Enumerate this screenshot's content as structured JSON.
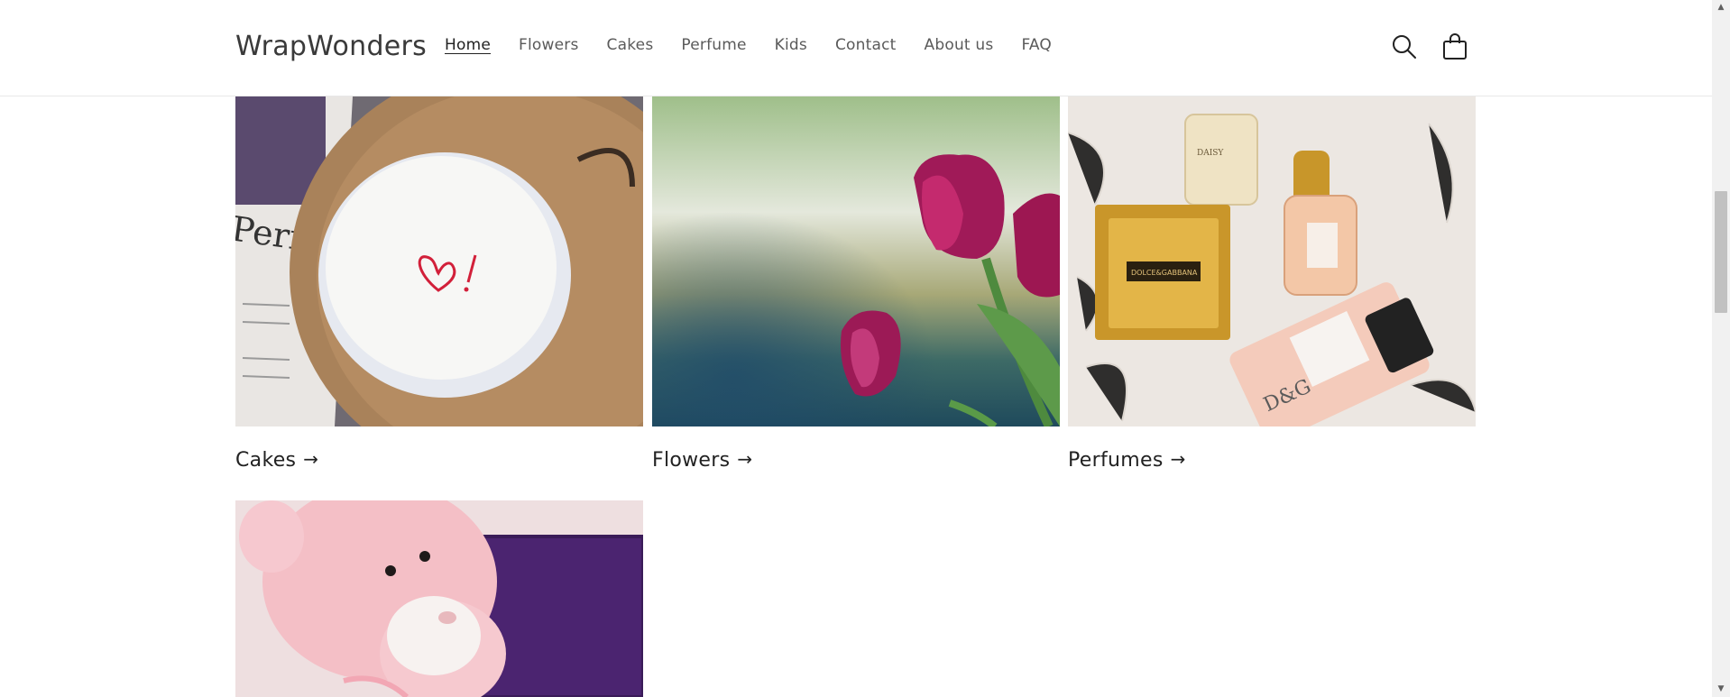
{
  "header": {
    "logo": "WrapWonders",
    "nav": [
      {
        "label": "Home",
        "active": true
      },
      {
        "label": "Flowers"
      },
      {
        "label": "Cakes"
      },
      {
        "label": "Perfume"
      },
      {
        "label": "Kids"
      },
      {
        "label": "Contact"
      },
      {
        "label": "About us"
      },
      {
        "label": "FAQ"
      }
    ],
    "icons": {
      "search": "search-icon",
      "cart": "cart-icon"
    }
  },
  "collections": [
    {
      "label": "Cakes"
    },
    {
      "label": "Flowers"
    },
    {
      "label": "Perfumes"
    },
    {
      "label": ""
    }
  ],
  "arrow": "→",
  "scrollbar": {
    "up": "▲",
    "down": "▼"
  },
  "colors": {
    "accent": "#121212",
    "nav_text": "#5a5a5a"
  }
}
